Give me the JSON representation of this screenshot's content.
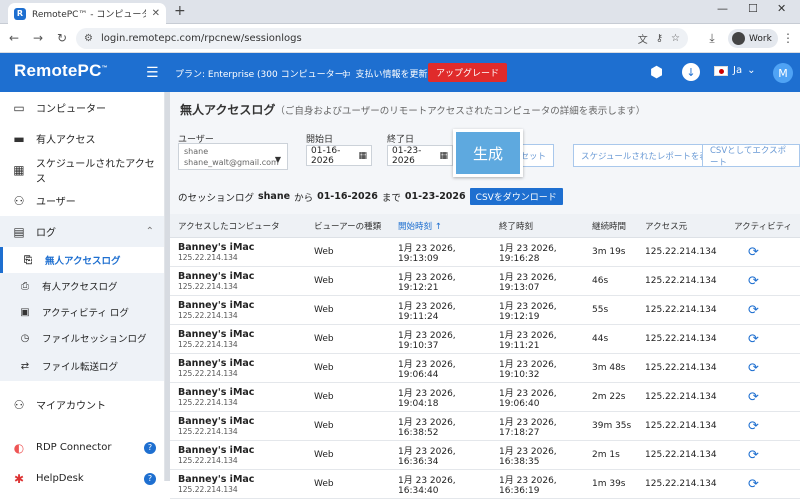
{
  "browser": {
    "tab_title": "RemotePC™ - コンピューター",
    "url": "login.remotepc.com/rpcnew/sessionlogs",
    "profile_label": "Work"
  },
  "header": {
    "logo": "RemotePC",
    "plan": "プラン: Enterprise (300 コンピューター)",
    "payment": "支払い情報を更新",
    "upgrade": "アップグレード",
    "lang": "Ja",
    "avatar": "M"
  },
  "sidebar": {
    "items": [
      {
        "label": "コンピューター",
        "icon": "monitor-icon"
      },
      {
        "label": "有人アクセス",
        "icon": "screen-icon"
      },
      {
        "label": "スケジュールされたアクセス",
        "icon": "calendar-icon"
      },
      {
        "label": "ユーザー",
        "icon": "user-icon"
      },
      {
        "label": "ログ",
        "icon": "log-icon"
      }
    ],
    "log_sub": [
      {
        "label": "無人アクセスログ"
      },
      {
        "label": "有人アクセスログ"
      },
      {
        "label": "アクティビティ ログ"
      },
      {
        "label": "ファイルセッションログ"
      },
      {
        "label": "ファイル転送ログ"
      }
    ],
    "bottom": [
      {
        "label": "マイアカウント"
      },
      {
        "label": "RDP Connector"
      },
      {
        "label": "HelpDesk"
      }
    ]
  },
  "main": {
    "title": "無人アクセスログ",
    "subtitle": "（ご自身およびユーザーのリモートアクセスされたコンピュータの詳細を表示します）",
    "user_label": "ユーザー",
    "user_name": "shane",
    "user_email": "shane_walt@gmail.com",
    "start_label": "開始日",
    "start_date": "01-16-2026",
    "end_label": "終了日",
    "end_date": "01-23-2026",
    "generate": "生成",
    "reset": "セット",
    "scheduled_report": "スケジュールされたレポートを表示",
    "export_csv": "CSVとしてエクスポート",
    "sess_prefix": "のセッションログ",
    "sess_user": "shane",
    "sess_from": "から",
    "sess_start": "01-16-2026",
    "sess_to": "まで",
    "sess_end": "01-23-2026",
    "download_csv": "CSVをダウンロード"
  },
  "table": {
    "headers": [
      "アクセスしたコンピュータ",
      "ビューアーの種類",
      "開始時刻 ↑",
      "終了時刻",
      "継続時間",
      "アクセス元",
      "アクティビティ"
    ],
    "rows": [
      {
        "computer": "Banney's iMac",
        "ip": "125.22.214.134",
        "viewer": "Web",
        "start": "1月 23 2026, 19:13:09",
        "end": "1月 23 2026, 19:16:28",
        "duration": "3m 19s",
        "from": "125.22.214.134"
      },
      {
        "computer": "Banney's iMac",
        "ip": "125.22.214.134",
        "viewer": "Web",
        "start": "1月 23 2026, 19:12:21",
        "end": "1月 23 2026, 19:13:07",
        "duration": "46s",
        "from": "125.22.214.134"
      },
      {
        "computer": "Banney's iMac",
        "ip": "125.22.214.134",
        "viewer": "Web",
        "start": "1月 23 2026, 19:11:24",
        "end": "1月 23 2026, 19:12:19",
        "duration": "55s",
        "from": "125.22.214.134"
      },
      {
        "computer": "Banney's iMac",
        "ip": "125.22.214.134",
        "viewer": "Web",
        "start": "1月 23 2026, 19:10:37",
        "end": "1月 23 2026, 19:11:21",
        "duration": "44s",
        "from": "125.22.214.134"
      },
      {
        "computer": "Banney's iMac",
        "ip": "125.22.214.134",
        "viewer": "Web",
        "start": "1月 23 2026, 19:06:44",
        "end": "1月 23 2026, 19:10:32",
        "duration": "3m 48s",
        "from": "125.22.214.134"
      },
      {
        "computer": "Banney's iMac",
        "ip": "125.22.214.134",
        "viewer": "Web",
        "start": "1月 23 2026, 19:04:18",
        "end": "1月 23 2026, 19:06:40",
        "duration": "2m 22s",
        "from": "125.22.214.134"
      },
      {
        "computer": "Banney's iMac",
        "ip": "125.22.214.134",
        "viewer": "Web",
        "start": "1月 23 2026, 16:38:52",
        "end": "1月 23 2026, 17:18:27",
        "duration": "39m 35s",
        "from": "125.22.214.134"
      },
      {
        "computer": "Banney's iMac",
        "ip": "125.22.214.134",
        "viewer": "Web",
        "start": "1月 23 2026, 16:36:34",
        "end": "1月 23 2026, 16:38:35",
        "duration": "2m 1s",
        "from": "125.22.214.134"
      },
      {
        "computer": "Banney's iMac",
        "ip": "125.22.214.134",
        "viewer": "Web",
        "start": "1月 23 2026, 16:34:40",
        "end": "1月 23 2026, 16:36:19",
        "duration": "1m 39s",
        "from": "125.22.214.134"
      }
    ]
  }
}
